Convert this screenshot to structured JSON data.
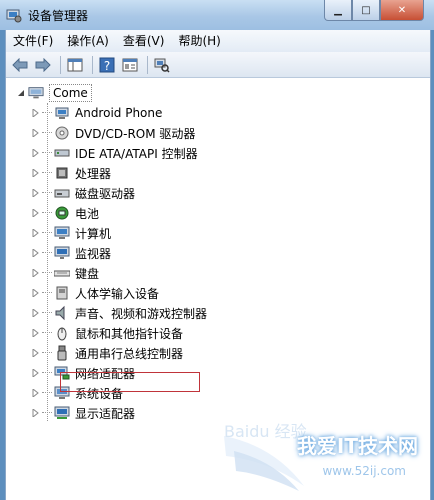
{
  "window": {
    "title": "设备管理器"
  },
  "menu": [
    {
      "label": "文件(F)"
    },
    {
      "label": "操作(A)"
    },
    {
      "label": "查看(V)"
    },
    {
      "label": "帮助(H)"
    }
  ],
  "tree": {
    "root": "Come",
    "items": [
      {
        "label": "Android Phone",
        "icon": "phone-device-icon"
      },
      {
        "label": "DVD/CD-ROM 驱动器",
        "icon": "disc-drive-icon"
      },
      {
        "label": "IDE ATA/ATAPI 控制器",
        "icon": "ide-controller-icon"
      },
      {
        "label": "处理器",
        "icon": "processor-icon"
      },
      {
        "label": "磁盘驱动器",
        "icon": "disk-drive-icon"
      },
      {
        "label": "电池",
        "icon": "battery-icon"
      },
      {
        "label": "计算机",
        "icon": "computer-icon"
      },
      {
        "label": "监视器",
        "icon": "monitor-icon"
      },
      {
        "label": "键盘",
        "icon": "keyboard-icon"
      },
      {
        "label": "人体学输入设备",
        "icon": "hid-icon"
      },
      {
        "label": "声音、视频和游戏控制器",
        "icon": "speaker-icon"
      },
      {
        "label": "鼠标和其他指针设备",
        "icon": "mouse-icon"
      },
      {
        "label": "通用串行总线控制器",
        "icon": "usb-icon"
      },
      {
        "label": "网络适配器",
        "icon": "network-adapter-icon"
      },
      {
        "label": "系统设备",
        "icon": "system-device-icon"
      },
      {
        "label": "显示适配器",
        "icon": "display-adapter-icon"
      }
    ]
  },
  "watermark": {
    "logo": "Baidu 经验",
    "site_name": "我爱IT技术网",
    "url": "www.52ij.com"
  },
  "colors": {
    "titlebar": "#a9c7e6",
    "highlight_border": "#c0343a"
  }
}
